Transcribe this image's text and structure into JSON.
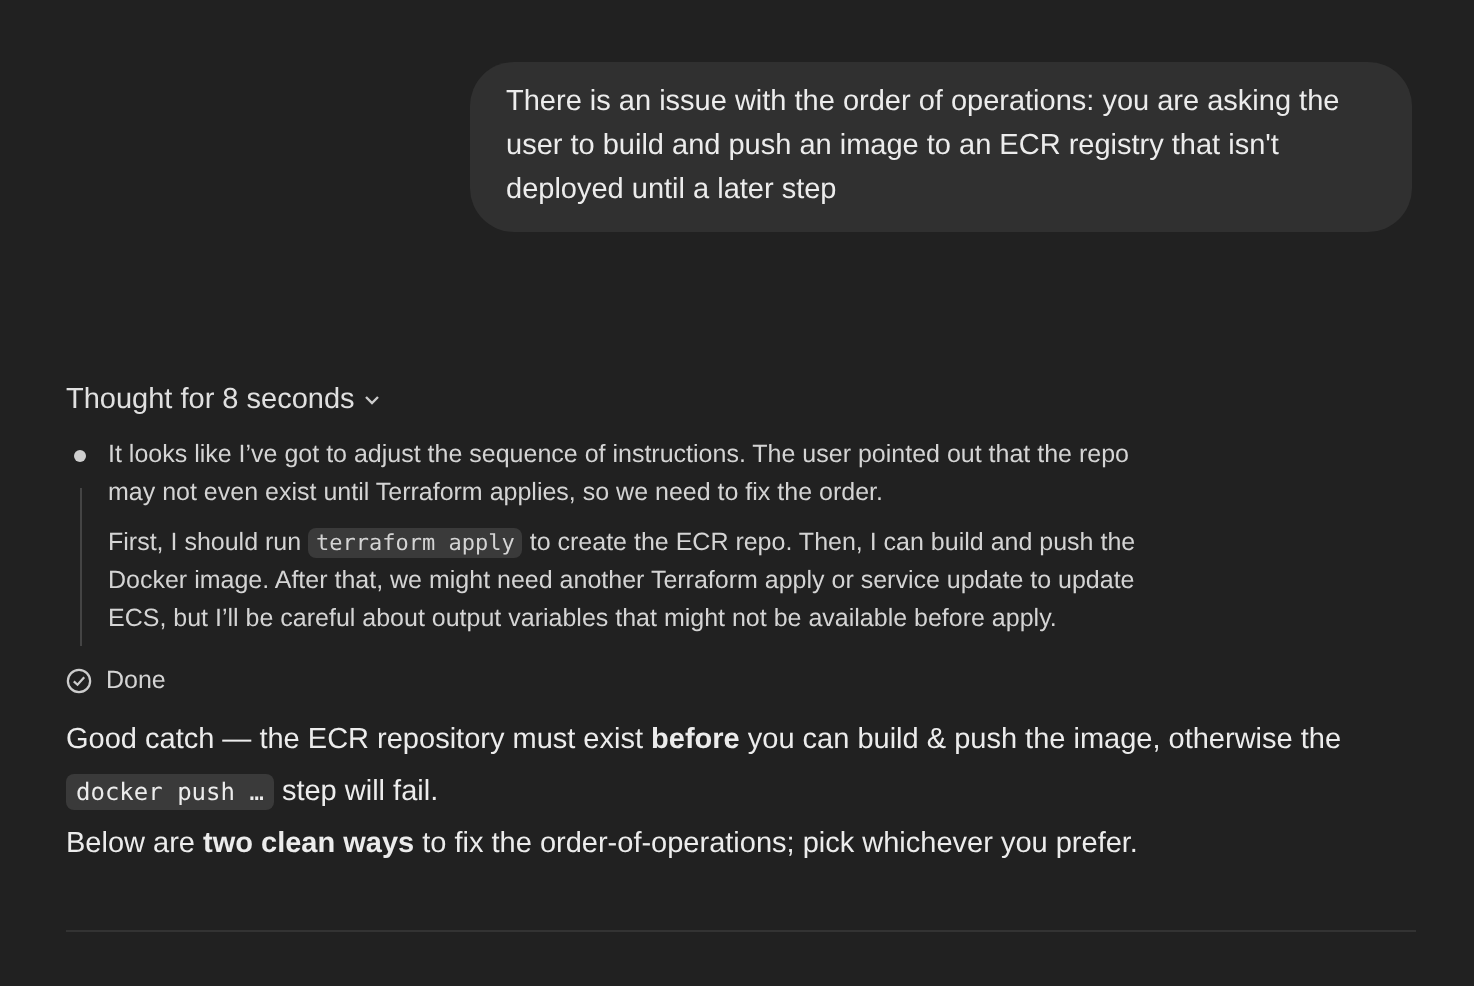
{
  "user_message": {
    "text": "There is an issue with the order of operations: you are asking the user to build and push an image to an ECR registry that isn't deployed until a later step"
  },
  "thought": {
    "heading": "Thought for 8 seconds",
    "expanded": true,
    "paragraphs": [
      [
        {
          "kind": "text",
          "text": "It looks like I’ve got to adjust the sequence of instructions. The user pointed out that the repo may not even exist until Terraform applies, so we need to fix the order."
        }
      ],
      [
        {
          "kind": "text",
          "text": "First, I should run "
        },
        {
          "kind": "code",
          "text": "terraform apply"
        },
        {
          "kind": "text",
          "text": " to create the ECR repo. Then, I can build and push the Docker image. After that, we might need another Terraform apply or service update to update ECS, but I’ll be careful about output variables that might not be available before apply."
        }
      ]
    ],
    "status": "Done"
  },
  "answer": [
    [
      {
        "kind": "text",
        "text": "Good catch — the ECR repository must exist **before** you can build & push the image, otherwise the "
      },
      {
        "kind": "code",
        "text": "docker push …"
      },
      {
        "kind": "text",
        "text": " step will fail."
      }
    ],
    [
      {
        "kind": "text",
        "text": "Below are **two clean ways** to fix the order-of-operations; pick whichever you prefer."
      }
    ]
  ]
}
